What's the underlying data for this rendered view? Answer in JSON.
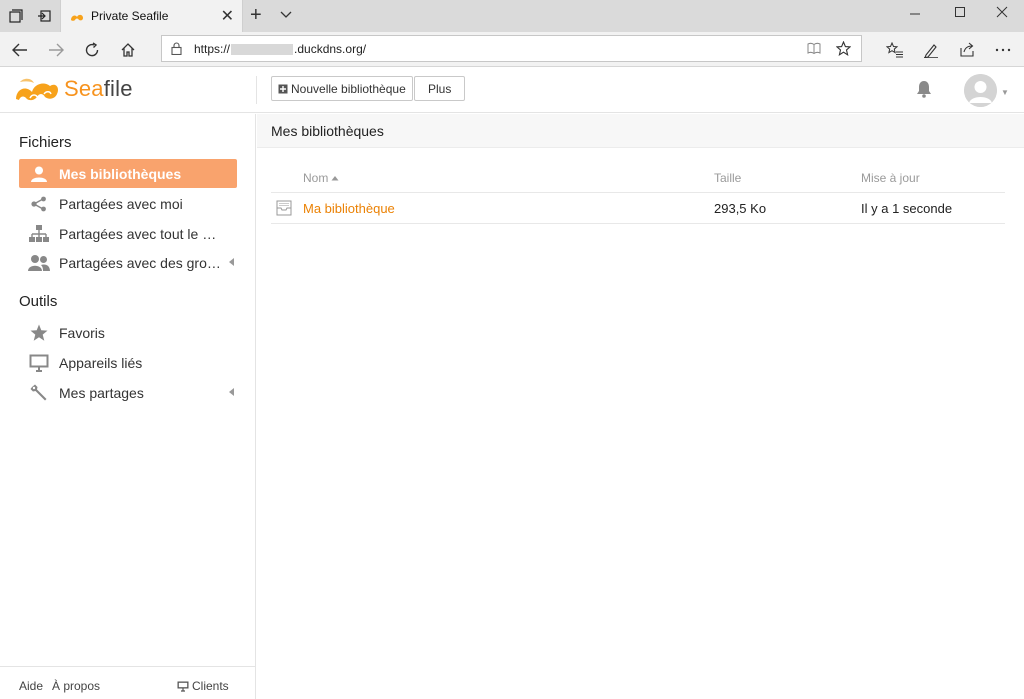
{
  "browser": {
    "tab_title": "Private Seafile",
    "url_prefix": "https://",
    "url_domain": ".duckdns.org/"
  },
  "app": {
    "logo_sea": "Sea",
    "logo_file": "file",
    "toolbar": {
      "new_library": "Nouvelle bibliothèque",
      "more": "Plus"
    },
    "sidebar": {
      "files_heading": "Fichiers",
      "files_items": [
        {
          "label": "Mes bibliothèques",
          "icon": "user-icon",
          "active": true
        },
        {
          "label": "Partagées avec moi",
          "icon": "share-icon"
        },
        {
          "label": "Partagées avec tout le monde",
          "icon": "org-chart-icon"
        },
        {
          "label": "Partagées avec des groupes",
          "icon": "group-icon"
        }
      ],
      "tools_heading": "Outils",
      "tools_items": [
        {
          "label": "Favoris",
          "icon": "star-icon"
        },
        {
          "label": "Appareils liés",
          "icon": "monitor-icon"
        },
        {
          "label": "Mes partages",
          "icon": "wrench-icon"
        }
      ],
      "footer": {
        "help": "Aide",
        "about": "À propos",
        "clients": "Clients"
      }
    },
    "main": {
      "title": "Mes bibliothèques",
      "columns": {
        "name": "Nom",
        "size": "Taille",
        "updated": "Mise à jour"
      },
      "rows": [
        {
          "name": "Ma bibliothèque",
          "size": "293,5 Ko",
          "updated": "Il y a 1 seconde"
        }
      ]
    },
    "colors": {
      "accent": "#f9a36d",
      "link": "#eb8205",
      "brand": "#f7931e"
    }
  }
}
